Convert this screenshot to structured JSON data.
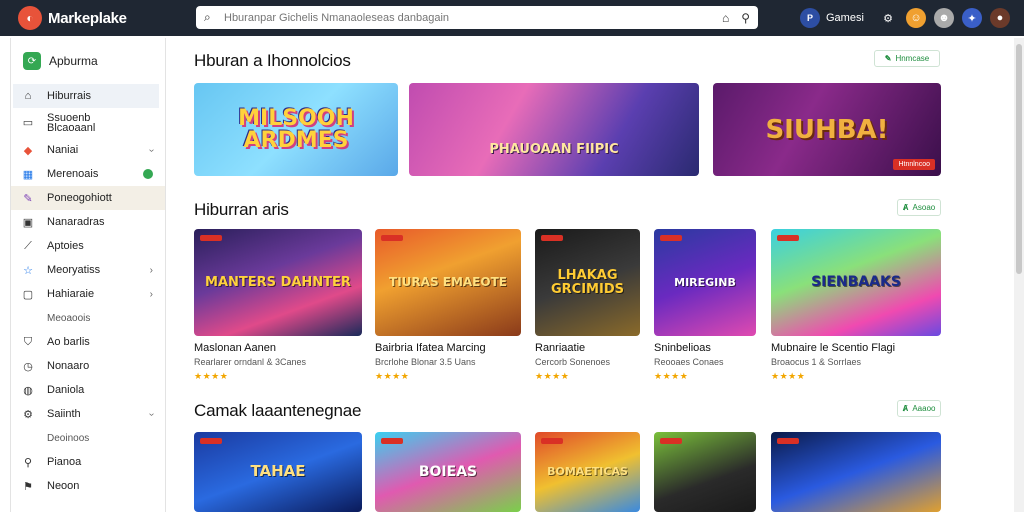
{
  "topbar": {
    "brand_icon": "marketplace-logo-icon",
    "brand": "Markeplake",
    "search_placeholder": "Hburanpar Gichelis Nmanaoleseas danbagain",
    "search_icon": "search-icon",
    "account_initials": "P",
    "account_label": "Gamesi",
    "colors": {
      "bar": "#1f2733",
      "accent": "#e8533a"
    }
  },
  "sidebar": {
    "header": "Apburma",
    "items": [
      {
        "icon": "home-icon",
        "label": "Hiburrais",
        "state": "active"
      },
      {
        "icon": "library-icon",
        "label": "Ssuoenb\nBlcaoaanl"
      },
      {
        "icon": "tag-icon",
        "label": "Naniai",
        "chevron": true
      },
      {
        "icon": "grid-icon",
        "label": "Merenoais",
        "dot": true
      },
      {
        "icon": "puzzle-icon",
        "label": "Poneogohiott",
        "state": "highlight"
      },
      {
        "icon": "list-icon",
        "label": "Nanaradras"
      },
      {
        "icon": "wand-icon",
        "label": "Aptoies"
      },
      {
        "icon": "star-icon",
        "label": "Meoryatiss",
        "chevron": true
      },
      {
        "icon": "box-icon",
        "label": "Hahiaraie",
        "chevron": true
      },
      {
        "icon": "",
        "label": "Meoaoois",
        "sub": true
      },
      {
        "icon": "shield-icon",
        "label": "Ao barlis"
      },
      {
        "icon": "clock-icon",
        "label": "Nonaaro"
      },
      {
        "icon": "globe-icon",
        "label": "Daniola"
      },
      {
        "icon": "settings-icon",
        "label": "Saiinth",
        "chevron": true
      },
      {
        "icon": "",
        "label": "Deoinoos",
        "sub": true
      },
      {
        "icon": "pin-icon",
        "label": "Pianoa"
      },
      {
        "icon": "flag-icon",
        "label": "Neoon"
      }
    ]
  },
  "main": {
    "section1": {
      "title": "Hburan a Ihonnolcios",
      "button": "Hnmcase",
      "banners": [
        {
          "title": "MILSOOH ARDMES",
          "tag": ""
        },
        {
          "title": "PHAUOAAN FIIPIC",
          "tag": ""
        },
        {
          "title": "SIUHBA!",
          "tag": "Htnnlncoo"
        }
      ]
    },
    "section2": {
      "title": "Hiburran aris",
      "button": "Asoao",
      "cards": [
        {
          "thumb_title": "MANTERS DAHNTER",
          "name": "Maslonan Aanen",
          "sub": "Rearlarer orndanl & 3Canes",
          "rating": "★★★★"
        },
        {
          "thumb_title": "TIURAS EMAEOTE",
          "name": "Bairbria Ifatea Marcing",
          "sub": "Brcrlohe Blonar 3.5 Uans",
          "rating": "★★★★"
        },
        {
          "thumb_title": "LHAKAG GRCIMIDS",
          "name": "Ranriaatie",
          "sub": "Cercorb Sonenoes",
          "rating": "★★★★"
        },
        {
          "thumb_title": "MIREGINB",
          "name": "Sninbelioas",
          "sub": "Reooaes Conaes",
          "rating": "★★★★"
        },
        {
          "thumb_title": "SIENBAAKS",
          "name": "Mubnaire le Scentio Flagi",
          "sub": "Broaocus 1 & Sorrlaes",
          "rating": "★★★★"
        }
      ]
    },
    "section3": {
      "title": "Camak laaantenegnae",
      "button": "Aaaoo",
      "cards": [
        {
          "thumb_title": "TAHAE"
        },
        {
          "thumb_title": "BOIEAS"
        },
        {
          "thumb_title": "BOMAETICAS"
        },
        {
          "thumb_title": ""
        },
        {
          "thumb_title": ""
        }
      ]
    }
  }
}
